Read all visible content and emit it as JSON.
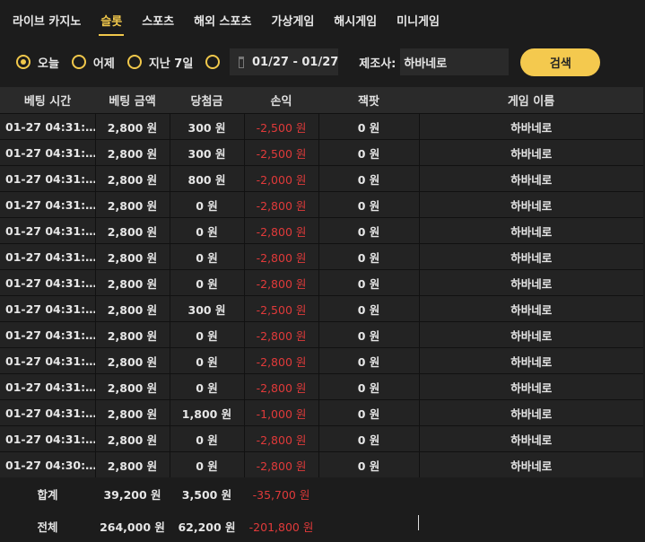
{
  "tabs": [
    {
      "label": "라이브 카지노",
      "active": false
    },
    {
      "label": "슬롯",
      "active": true
    },
    {
      "label": "스포츠",
      "active": false
    },
    {
      "label": "해외 스포츠",
      "active": false
    },
    {
      "label": "가상게임",
      "active": false
    },
    {
      "label": "해시게임",
      "active": false
    },
    {
      "label": "미니게임",
      "active": false
    }
  ],
  "filters": {
    "today": "오늘",
    "yesterday": "어제",
    "last7": "지난 7일",
    "date_range": "01/27 - 01/27",
    "maker_label": "제조사:",
    "maker_value": "하바네로",
    "search": "검색"
  },
  "columns": [
    "베팅 시간",
    "베팅 금액",
    "당첨금",
    "손익",
    "잭팟",
    "게임 이름"
  ],
  "rows": [
    [
      "01-27 04:31:…",
      "2,800 원",
      "300 원",
      "-2,500 원",
      "0 원",
      "하바네로"
    ],
    [
      "01-27 04:31:…",
      "2,800 원",
      "300 원",
      "-2,500 원",
      "0 원",
      "하바네로"
    ],
    [
      "01-27 04:31:…",
      "2,800 원",
      "800 원",
      "-2,000 원",
      "0 원",
      "하바네로"
    ],
    [
      "01-27 04:31:…",
      "2,800 원",
      "0 원",
      "-2,800 원",
      "0 원",
      "하바네로"
    ],
    [
      "01-27 04:31:…",
      "2,800 원",
      "0 원",
      "-2,800 원",
      "0 원",
      "하바네로"
    ],
    [
      "01-27 04:31:…",
      "2,800 원",
      "0 원",
      "-2,800 원",
      "0 원",
      "하바네로"
    ],
    [
      "01-27 04:31:…",
      "2,800 원",
      "0 원",
      "-2,800 원",
      "0 원",
      "하바네로"
    ],
    [
      "01-27 04:31:…",
      "2,800 원",
      "300 원",
      "-2,500 원",
      "0 원",
      "하바네로"
    ],
    [
      "01-27 04:31:…",
      "2,800 원",
      "0 원",
      "-2,800 원",
      "0 원",
      "하바네로"
    ],
    [
      "01-27 04:31:…",
      "2,800 원",
      "0 원",
      "-2,800 원",
      "0 원",
      "하바네로"
    ],
    [
      "01-27 04:31:…",
      "2,800 원",
      "0 원",
      "-2,800 원",
      "0 원",
      "하바네로"
    ],
    [
      "01-27 04:31:…",
      "2,800 원",
      "1,800 원",
      "-1,000 원",
      "0 원",
      "하바네로"
    ],
    [
      "01-27 04:31:…",
      "2,800 원",
      "0 원",
      "-2,800 원",
      "0 원",
      "하바네로"
    ],
    [
      "01-27 04:30:…",
      "2,800 원",
      "0 원",
      "-2,800 원",
      "0 원",
      "하바네로"
    ]
  ],
  "summary": {
    "label": "합계",
    "bet": "39,200 원",
    "win": "3,500 원",
    "pl": "-35,700 원"
  },
  "total": {
    "label": "전체",
    "bet": "264,000 원",
    "win": "62,200 원",
    "pl": "-201,800 원"
  },
  "colors": {
    "accent": "#f1c84b",
    "negative": "#e03a3a",
    "button": "#f4c94e"
  }
}
